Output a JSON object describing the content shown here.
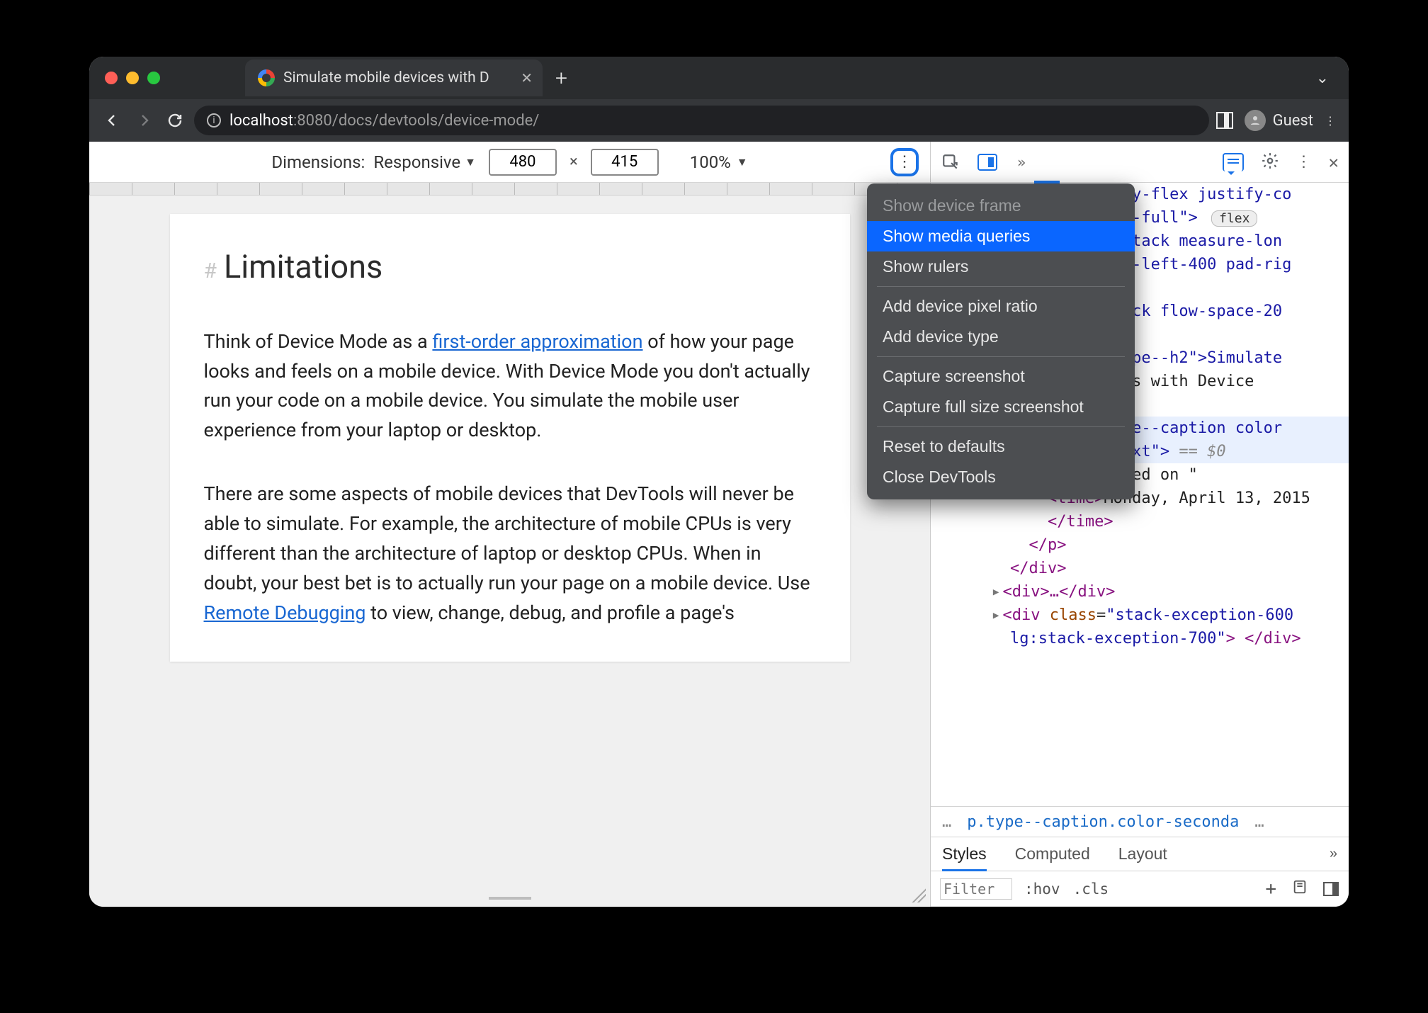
{
  "browser": {
    "tab_title": "Simulate mobile devices with D",
    "url_host": "localhost",
    "url_port": ":8080",
    "url_path": "/docs/devtools/device-mode/",
    "guest_label": "Guest"
  },
  "device_toolbar": {
    "dimensions_label": "Dimensions:",
    "dimensions_mode": "Responsive",
    "width_value": "480",
    "height_value": "415",
    "zoom_value": "100%"
  },
  "context_menu": {
    "items": [
      {
        "label": "Show device frame",
        "state": "disabled"
      },
      {
        "label": "Show media queries",
        "state": "hover"
      },
      {
        "label": "Show rulers",
        "state": ""
      }
    ],
    "group2": [
      {
        "label": "Add device pixel ratio"
      },
      {
        "label": "Add device type"
      }
    ],
    "group3": [
      {
        "label": "Capture screenshot"
      },
      {
        "label": "Capture full size screenshot"
      }
    ],
    "group4": [
      {
        "label": "Reset to defaults"
      },
      {
        "label": "Close DevTools"
      }
    ]
  },
  "page": {
    "heading": "Limitations",
    "p1_a": "Think of Device Mode as a ",
    "p1_link": "first-order approximation",
    "p1_b": " of how your page looks and feels on a mobile device. With Device Mode you don't actually run your code on a mobile device. You simulate the mobile user experience from your laptop or desktop.",
    "p2_a": "There are some aspects of mobile devices that DevTools will never be able to simulate. For example, the architecture of mobile CPUs is very different than the architecture of laptop or desktop CPUs. When in doubt, your best bet is to actually run your page on a mobile device. Use ",
    "p2_link": "Remote Debugging",
    "p2_b": " to view, change, debug, and profile a page's"
  },
  "elements": {
    "l1a": "y-flex justify-co",
    "l1b": "-full\">",
    "flex_badge": "flex",
    "l2": "tack measure-lon",
    "l3": "-left-400 pad-rig",
    "l4": "ck flow-space-20",
    "l5": "pe--h2\">Simulate",
    "l6": "s with Device",
    "l7": "e--caption color",
    "l8": "xt\">",
    "eq0": " == $0",
    "pub": "\" Published on \"",
    "time_open": "<time>",
    "time_text": "Monday, April 13, 2015",
    "time_close": "</time>",
    "p_close": "</p>",
    "div_close": "</div>",
    "collapsed_div": "<div>…</div>",
    "last": "<div class=\"stack-exception-600 lg:stack-exception-700\"> </div>"
  },
  "breadcrumb": {
    "left": "…",
    "mid": "p.type--caption.color-seconda",
    "right": "…"
  },
  "styles_tabs": {
    "t1": "Styles",
    "t2": "Computed",
    "t3": "Layout"
  },
  "styles_row": {
    "filter_placeholder": "Filter",
    "hov": ":hov",
    "cls": ".cls",
    "plus": "+"
  }
}
